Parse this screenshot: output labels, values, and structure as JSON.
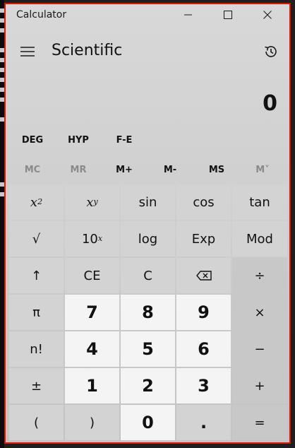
{
  "window": {
    "title": "Calculator",
    "controls": {
      "minimize": "minimize-icon",
      "maximize": "maximize-icon",
      "close": "close-icon"
    }
  },
  "header": {
    "menu_icon": "hamburger-menu-icon",
    "mode_title": "Scientific",
    "history_icon": "history-icon"
  },
  "display": {
    "value": "0"
  },
  "mode_buttons": {
    "angle": "DEG",
    "hyperbolic": "HYP",
    "notation": "F-E"
  },
  "memory": {
    "mc": "MC",
    "mr": "MR",
    "m_plus": "M+",
    "m_minus": "M-",
    "ms": "MS",
    "m_list": "M˅"
  },
  "keys": {
    "x_squared": {
      "base": "x",
      "sup": "2"
    },
    "x_pow_y": {
      "base": "x",
      "sup": "y"
    },
    "sin": "sin",
    "cos": "cos",
    "tan": "tan",
    "sqrt": "√",
    "ten_pow_x": {
      "base": "10",
      "sup": "x"
    },
    "log": "log",
    "exp": "Exp",
    "mod": "Mod",
    "shift": "↑",
    "ce": "CE",
    "c": "C",
    "backspace": "backspace-icon",
    "divide": "÷",
    "pi": "π",
    "n7": "7",
    "n8": "8",
    "n9": "9",
    "multiply": "×",
    "factorial": "n!",
    "n4": "4",
    "n5": "5",
    "n6": "6",
    "minus": "−",
    "negate": "±",
    "n1": "1",
    "n2": "2",
    "n3": "3",
    "plus": "+",
    "lparen": "(",
    "rparen": ")",
    "n0": "0",
    "decimal": ".",
    "equals": "="
  },
  "colors": {
    "window_border": "#e51400",
    "digit_key_bg": "#f4f4f4",
    "function_key_bg": "#d3d3d3"
  }
}
